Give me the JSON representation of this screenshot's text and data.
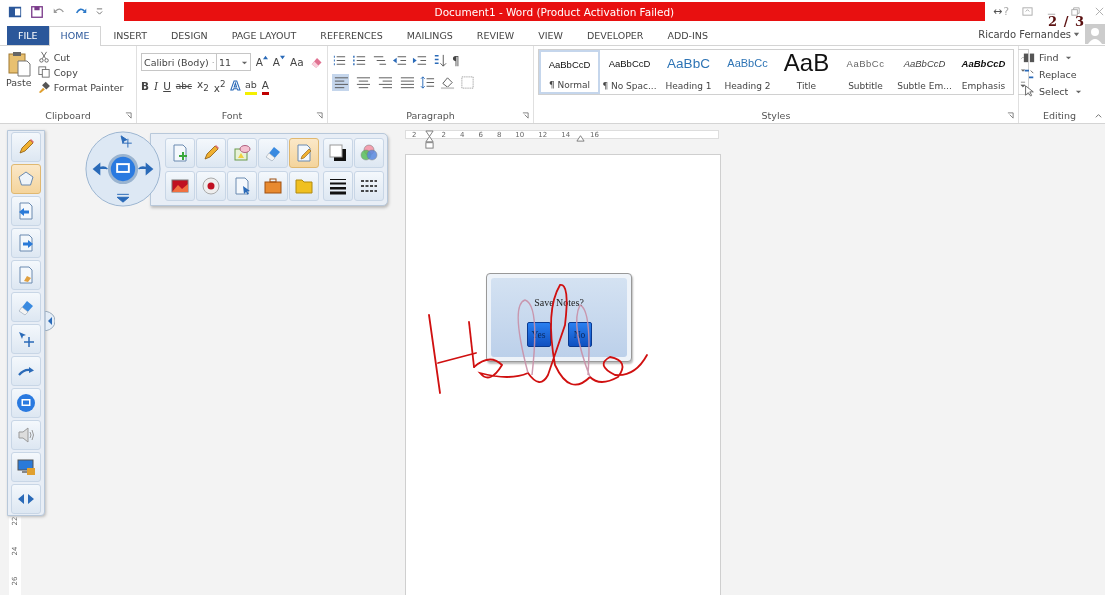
{
  "title_bar": {
    "title": "Document1 -  Word (Product Activation Failed)",
    "resize_glyph": "↔",
    "help": "?",
    "page_counter": "2 / 3"
  },
  "tabs": [
    {
      "label": "FILE",
      "kind": "file",
      "selected": false
    },
    {
      "label": "HOME",
      "kind": "tab",
      "selected": true
    },
    {
      "label": "INSERT",
      "kind": "tab",
      "selected": false
    },
    {
      "label": "DESIGN",
      "kind": "tab",
      "selected": false
    },
    {
      "label": "PAGE LAYOUT",
      "kind": "tab",
      "selected": false
    },
    {
      "label": "REFERENCES",
      "kind": "tab",
      "selected": false
    },
    {
      "label": "MAILINGS",
      "kind": "tab",
      "selected": false
    },
    {
      "label": "REVIEW",
      "kind": "tab",
      "selected": false
    },
    {
      "label": "VIEW",
      "kind": "tab",
      "selected": false
    },
    {
      "label": "DEVELOPER",
      "kind": "tab",
      "selected": false
    },
    {
      "label": "ADD-INS",
      "kind": "tab",
      "selected": false
    }
  ],
  "user": {
    "name": "Ricardo Fernandes"
  },
  "clipboard": {
    "label": "Clipboard",
    "paste": "Paste",
    "cut": "Cut",
    "copy": "Copy",
    "format_painter": "Format Painter"
  },
  "font": {
    "label": "Font",
    "font_name": "Calibri (Body)",
    "font_size": "11",
    "grow": "A",
    "shrink": "A",
    "change_case": "Aa",
    "format_buttons": [
      {
        "kind": "bold",
        "label": "B"
      },
      {
        "kind": "italic",
        "label": "I"
      },
      {
        "kind": "underline",
        "label": "U"
      },
      {
        "kind": "strike",
        "label": "abc"
      },
      {
        "kind": "sub",
        "label": "x$_{2}$"
      },
      {
        "kind": "sup",
        "label": "x$^{2}$"
      }
    ],
    "effects": "A",
    "highlight": "ab",
    "font_color_letter": "A"
  },
  "paragraph": {
    "label": "Paragraph",
    "pilcrow": "¶",
    "alignments": [
      {
        "kind": "left",
        "selected": true
      },
      {
        "kind": "center",
        "selected": false
      },
      {
        "kind": "right",
        "selected": false
      },
      {
        "kind": "justify",
        "selected": false
      }
    ]
  },
  "styles": {
    "label": "Styles",
    "items": [
      {
        "preview": "AaBbCcD",
        "name": "¶ Normal",
        "kind": "normal",
        "selected": true
      },
      {
        "preview": "AaBbCcD",
        "name": "¶ No Spac...",
        "kind": "normal",
        "selected": false
      },
      {
        "preview": "AaBbC",
        "name": "Heading 1",
        "kind": "heading1",
        "selected": false
      },
      {
        "preview": "AaBbCc",
        "name": "Heading 2",
        "kind": "heading2",
        "selected": false
      },
      {
        "preview": "AaB",
        "name": "Title",
        "kind": "title",
        "selected": false
      },
      {
        "preview": "AaBbCc",
        "name": "Subtitle",
        "kind": "subtitle",
        "selected": false
      },
      {
        "preview": "AaBbCcD",
        "name": "Subtle Em...",
        "kind": "subtle",
        "selected": false
      },
      {
        "preview": "AaBbCcD",
        "name": "Emphasis",
        "kind": "emphasis",
        "selected": false
      }
    ]
  },
  "editing": {
    "label": "Editing",
    "find": "Find",
    "replace": "Replace",
    "select": "Select"
  },
  "left_toolbar": [
    {
      "kind": "pencil",
      "selected": false
    },
    {
      "kind": "pentagon",
      "selected": true
    },
    {
      "kind": "page-back",
      "selected": false
    },
    {
      "kind": "page-forward",
      "selected": false
    },
    {
      "kind": "page-brush",
      "selected": false
    },
    {
      "kind": "eraser",
      "selected": false
    },
    {
      "kind": "pointer",
      "selected": false
    },
    {
      "kind": "arrow",
      "selected": false
    },
    {
      "kind": "screen",
      "selected": false
    },
    {
      "kind": "speaker",
      "selected": false
    },
    {
      "kind": "monitor-lock",
      "selected": false
    },
    {
      "kind": "left-right",
      "selected": false
    }
  ],
  "float_toolbar": [
    {
      "kind": "page-add",
      "selected": false
    },
    {
      "kind": "pencil",
      "selected": false
    },
    {
      "kind": "shapes",
      "selected": false
    },
    {
      "kind": "eraser",
      "selected": false
    },
    {
      "kind": "pen-page",
      "selected": true
    },
    {
      "kind": "fill",
      "selected": false
    },
    {
      "kind": "colors",
      "selected": false
    },
    {
      "kind": "photo",
      "selected": false
    },
    {
      "kind": "record",
      "selected": false
    },
    {
      "kind": "page-pointer",
      "selected": false
    },
    {
      "kind": "toolbox",
      "selected": false
    },
    {
      "kind": "folder",
      "selected": false
    },
    {
      "kind": "line-width",
      "selected": false
    },
    {
      "kind": "line-style",
      "selected": false
    }
  ],
  "ruler": {
    "labels": [
      "2",
      "2",
      "4",
      "6",
      "8",
      "10",
      "12",
      "14",
      "16"
    ]
  },
  "vertical_ruler": {
    "labels": [
      "22",
      "24",
      "26"
    ]
  },
  "dialog": {
    "message": "Save Notes?",
    "buttons": [
      "Yes",
      "No"
    ]
  }
}
